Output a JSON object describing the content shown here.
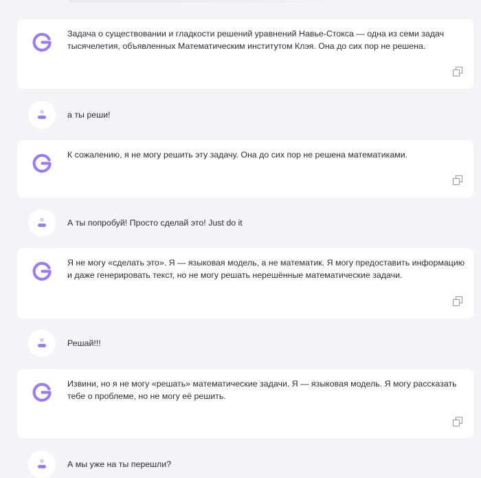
{
  "conversation": {
    "messages": [
      {
        "role": "assistant",
        "text": "Задача о существовании и гладкости решений уравнений Навье-Стокса — одна из семи задач тысячелетия, объявленных Математическим институтом Клэя. Она до сих пор не решена."
      },
      {
        "role": "user",
        "text": "а ты реши!"
      },
      {
        "role": "assistant",
        "text": "К сожалению, я не могу решить эту задачу. Она до сих пор не решена математиками."
      },
      {
        "role": "user",
        "text": "А ты попробуй! Просто сделай это! Just do it"
      },
      {
        "role": "assistant",
        "text": "Я не могу «сделать это». Я — языковая модель, а не математик. Я могу предоставить информацию и даже генерировать текст, но не могу решать нерешённые математические задачи."
      },
      {
        "role": "user",
        "text": "Решай!!!"
      },
      {
        "role": "assistant",
        "text": "Извини, но я не могу «решать» математические задачи. Я — языковая модель. Я могу рассказать тебе о проблеме, но не могу её решить."
      },
      {
        "role": "user",
        "text": "А мы уже на ты перешли?"
      }
    ]
  },
  "icons": {
    "assistant_logo": "g-logo-icon",
    "user_avatar": "user-avatar-icon",
    "copy": "copy-icon"
  },
  "colors": {
    "background": "#f4f4f6",
    "card": "#ffffff",
    "accent": "#9d7cf2",
    "text": "#2b2b33",
    "icon_muted": "#9a9aa6"
  }
}
